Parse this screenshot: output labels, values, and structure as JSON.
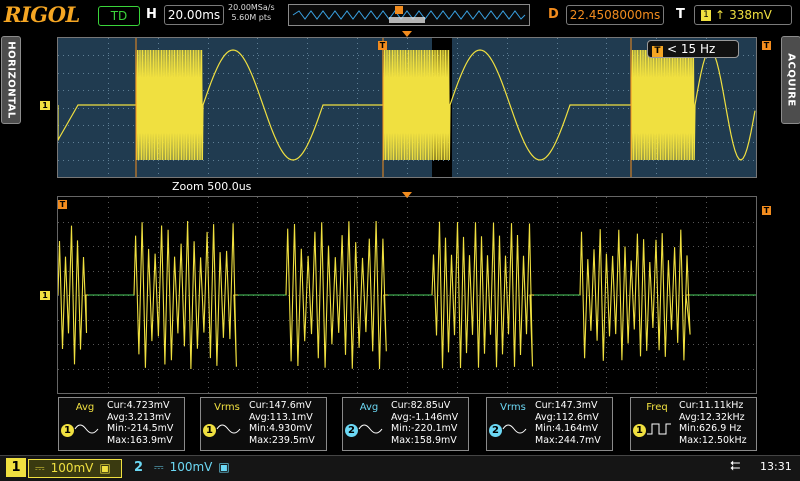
{
  "header": {
    "brand": "RIGOL",
    "run_state": "TD",
    "timebase_label": "H",
    "timebase": "20.00ms",
    "sample_rate": "20.00MSa/s",
    "memory_depth": "5.60M pts",
    "delay_label": "D",
    "delay": "22.4508000ms",
    "trigger_label": "T",
    "trigger_level": "338mV"
  },
  "side": {
    "left": "HORIZONTAL",
    "right": "ACQUIRE"
  },
  "main_view": {
    "freq_counter": "< 15 Hz",
    "trigger_marker": "T",
    "ch1_marker": "1"
  },
  "zoom_view": {
    "label": "Zoom  500.0us",
    "trigger_marker": "T",
    "ch1_marker": "1"
  },
  "measurements": [
    {
      "name": "Avg",
      "channel": "1",
      "lines": [
        "Cur:4.723mV",
        "Avg:3.213mV",
        "Min:-214.5mV",
        "Max:163.9mV"
      ]
    },
    {
      "name": "Vrms",
      "channel": "1",
      "lines": [
        "Cur:147.6mV",
        "Avg:113.1mV",
        "Min:4.930mV",
        "Max:239.5mV"
      ]
    },
    {
      "name": "Avg",
      "channel": "2",
      "lines": [
        "Cur:82.85uV",
        "Avg:-1.146mV",
        "Min:-220.1mV",
        "Max:158.9mV"
      ]
    },
    {
      "name": "Vrms",
      "channel": "2",
      "lines": [
        "Cur:147.3mV",
        "Avg:112.6mV",
        "Min:4.164mV",
        "Max:244.7mV"
      ]
    },
    {
      "name": "Freq",
      "channel": "1",
      "lines": [
        "Cur:11.11kHz",
        "Avg:12.32kHz",
        "Min:626.9 Hz",
        "Max:12.50kHz"
      ]
    }
  ],
  "status_bar": {
    "ch1_number": "1",
    "ch1_scale": "100mV",
    "ch2_number": "2",
    "ch2_scale": "100mV",
    "time": "13:31"
  },
  "colors": {
    "ch1": "#f0e040",
    "ch2": "#6cd8f4",
    "trigger": "#f28c1e",
    "main_bg": "#203b50"
  }
}
